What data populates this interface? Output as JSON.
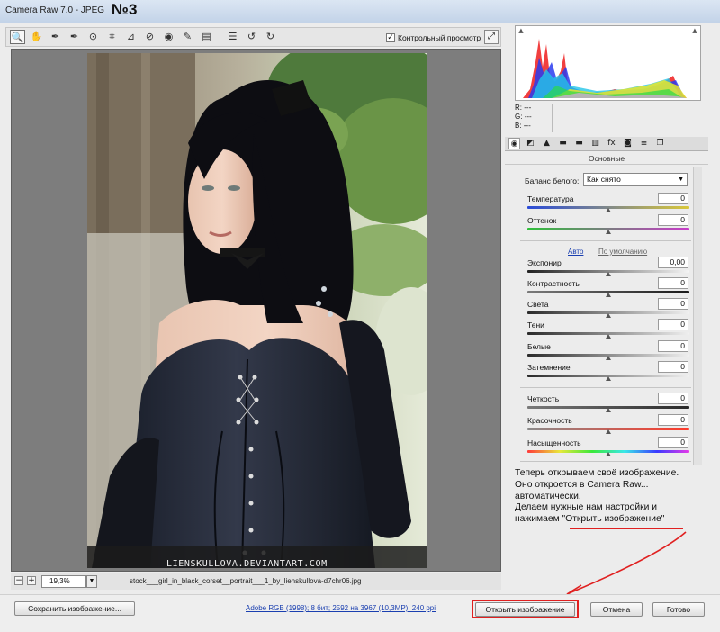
{
  "window": {
    "title": "Camera Raw 7.0  -  JPEG",
    "step_label": "№3"
  },
  "toolbar": {
    "tools": [
      {
        "icon": "zoom-icon",
        "glyph": "🔍",
        "active": true
      },
      {
        "icon": "hand-icon",
        "glyph": "✋",
        "active": false
      },
      {
        "icon": "white-balance-icon",
        "glyph": "✒",
        "active": false
      },
      {
        "icon": "color-sampler-icon",
        "glyph": "✒",
        "active": false
      },
      {
        "icon": "target-adjust-icon",
        "glyph": "⊙",
        "active": false
      },
      {
        "icon": "crop-icon",
        "glyph": "⌗",
        "active": false
      },
      {
        "icon": "straighten-icon",
        "glyph": "⊿",
        "active": false
      },
      {
        "icon": "spot-removal-icon",
        "glyph": "⊘",
        "active": false
      },
      {
        "icon": "red-eye-icon",
        "glyph": "◉",
        "active": false
      },
      {
        "icon": "adjustment-brush-icon",
        "glyph": "✎",
        "active": false
      },
      {
        "icon": "graduated-filter-icon",
        "glyph": "▤",
        "active": false
      },
      {
        "icon": "preferences-icon",
        "glyph": "☰",
        "active": false
      },
      {
        "icon": "rotate-left-icon",
        "glyph": "↺",
        "active": false
      },
      {
        "icon": "rotate-right-icon",
        "glyph": "↻",
        "active": false
      }
    ],
    "preview_label": "Контрольный просмотр",
    "preview_checked": true,
    "preview_check_glyph": "✓",
    "fullscreen_glyph": "⤢"
  },
  "preview": {
    "watermark": "LIENSKULLOVA.DEVIANTART.COM"
  },
  "zoom": {
    "minus": "−",
    "plus": "+",
    "value": "19,3%",
    "dropdown_glyph": "▼",
    "filename": "stock___girl_in_black_corset__portrait___1_by_lienskullova-d7chr06.jpg"
  },
  "histogram": {
    "clip_left_glyph": "▲",
    "clip_right_glyph": "▲",
    "readout": {
      "r": "R:",
      "g": "G:",
      "b": "B:",
      "r_val": "---",
      "g_val": "---",
      "b_val": "---"
    }
  },
  "panel_tabs": [
    {
      "icon": "basic-tab-icon",
      "glyph": "◉",
      "active": true
    },
    {
      "icon": "tone-curve-tab-icon",
      "glyph": "◩"
    },
    {
      "icon": "detail-tab-icon",
      "glyph": "▲"
    },
    {
      "icon": "hsl-tab-icon",
      "glyph": "▬"
    },
    {
      "icon": "split-toning-tab-icon",
      "glyph": "▬"
    },
    {
      "icon": "lens-tab-icon",
      "glyph": "▥"
    },
    {
      "icon": "effects-tab-icon",
      "glyph": "fx"
    },
    {
      "icon": "camera-calibration-tab-icon",
      "glyph": "◙"
    },
    {
      "icon": "presets-tab-icon",
      "glyph": "≣"
    },
    {
      "icon": "snapshots-tab-icon",
      "glyph": "❐"
    }
  ],
  "panel": {
    "title": "Основные",
    "white_balance_label": "Баланс белого:",
    "white_balance_value": "Как снято",
    "auto_label": "Авто",
    "default_label": "По умолчанию",
    "sliders": [
      {
        "id": "temperature",
        "label": "Температура",
        "value": "0",
        "level": 0.5,
        "colors": "#2a4bd8,#d9c83a"
      },
      {
        "id": "tint",
        "label": "Оттенок",
        "value": "0",
        "level": 0.5,
        "colors": "#2fbf3a,#c93ac9"
      },
      {
        "id": "exposure",
        "label": "Экспонир",
        "value": "0,00",
        "level": 0.5,
        "colors": "#222222,#f4f4f4"
      },
      {
        "id": "contrast",
        "label": "Контрастность",
        "value": "0",
        "level": 0.5,
        "colors": "#7a7a7a,#1a1a1a"
      },
      {
        "id": "highlights",
        "label": "Света",
        "value": "0",
        "level": 0.5,
        "colors": "#2a2a2a,#f0f0f0"
      },
      {
        "id": "shadows",
        "label": "Тени",
        "value": "0",
        "level": 0.5,
        "colors": "#2a2a2a,#f0f0f0"
      },
      {
        "id": "whites",
        "label": "Белые",
        "value": "0",
        "level": 0.5,
        "colors": "#2a2a2a,#f0f0f0"
      },
      {
        "id": "blacks",
        "label": "Затемнение",
        "value": "0",
        "level": 0.5,
        "colors": "#2a2a2a,#f0f0f0"
      },
      {
        "id": "clarity",
        "label": "Четкость",
        "value": "0",
        "level": 0.5,
        "colors": "#7a7a7a,#2a2a2a"
      },
      {
        "id": "vibrance",
        "label": "Красочность",
        "value": "0",
        "level": 0.5,
        "colors": "#8a8a8a,#ff3a2a"
      },
      {
        "id": "saturation",
        "label": "Насыщенность",
        "value": "0",
        "level": 0.5,
        "colors": "#ff3a3a,#e8e83a,#3ae83a,#3ae8e8,#3a3aff,#e83ae8"
      }
    ]
  },
  "annotation": {
    "line1": "Теперь открываем своё изображение.",
    "line2": "Оно откроется в Camera Raw...",
    "line3": "автоматически.",
    "line4": "Делаем нужные нам настройки и",
    "line5_prefix": "нажимаем \"",
    "line5_link": "Открыть изображение",
    "line5_suffix": "\""
  },
  "bottom": {
    "save_label": "Сохранить изображение...",
    "workflow_text": "Adobe RGB (1998); 8 бит; 2592 на 3967 (10,3МР); 240 ppi",
    "open_label": "Открыть изображение",
    "cancel_label": "Отмена",
    "done_label": "Готово"
  },
  "colors": {
    "accent": "#e02020",
    "link": "#1a3fb0"
  }
}
